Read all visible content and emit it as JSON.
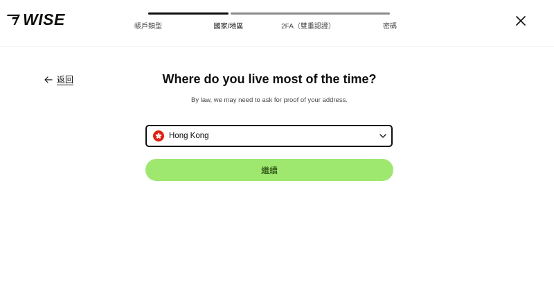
{
  "brand": {
    "logo_text": "WISE",
    "logo_icon": "wise-flag-icon"
  },
  "progress": {
    "steps": [
      {
        "label": "帳戶類型",
        "state": "done"
      },
      {
        "label": "國家/地區",
        "state": "active"
      },
      {
        "label": "2FA（雙重認證）",
        "state": "todo"
      },
      {
        "label": "密碼",
        "state": "todo"
      }
    ]
  },
  "header": {
    "close_icon": "close-icon"
  },
  "nav": {
    "back_label": "返回",
    "back_icon": "arrow-left-icon"
  },
  "main": {
    "title": "Where do you live most of the time?",
    "subtitle": "By law, we may need to ask for proof of your address."
  },
  "country_select": {
    "value": "Hong Kong",
    "flag_icon": "hong-kong-flag-icon",
    "chevron_icon": "chevron-down-icon"
  },
  "actions": {
    "continue_label": "繼續"
  },
  "colors": {
    "primary_button": "#9fe870",
    "primary_button_text": "#163300",
    "text": "#0e0f0c",
    "flag_red": "#de2110"
  }
}
